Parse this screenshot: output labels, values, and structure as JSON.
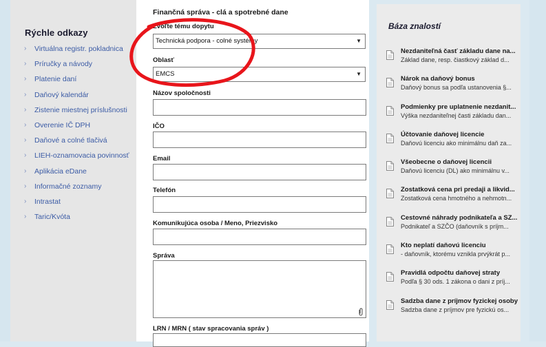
{
  "sidebar": {
    "heading": "Rýchle odkazy",
    "links": [
      "Virtuálna registr. pokladnica",
      "Príručky a návody",
      "Platenie daní",
      "Daňový kalendár",
      "Zistenie miestnej príslušnosti",
      "Overenie IČ DPH",
      "Daňové a colné tlačivá",
      "LIEH-oznamovacia povinnosť",
      "Aplikácia eDane",
      "Informačné zoznamy",
      "Intrastat",
      "Taric/Kvóta"
    ],
    "chevron_icon": "chevron-right-icon"
  },
  "form": {
    "title": "Finančná správa - clá a spotrebné dane",
    "topic_label": "Zvoľte tému dopytu",
    "topic_value": "Technická podpora - colné systémy",
    "area_label": "Oblasť",
    "area_value": "EMCS",
    "company_label": "Názov spoločnosti",
    "ico_label": "IČO",
    "email_label": "Email",
    "phone_label": "Telefón",
    "contact_label": "Komunikujúca osoba / Meno, Priezvisko",
    "message_label": "Správa",
    "lrn_label": "LRN / MRN ( stav spracovania správ )"
  },
  "annotation": {
    "color": "#e8151b",
    "shape": "hand-drawn-ellipse"
  },
  "knowledge_base": {
    "title": "Báza znalostí",
    "items": [
      {
        "title": "Nezdaniteľná časť základu dane na...",
        "snippet": "Základ dane, resp. čiastkový základ d..."
      },
      {
        "title": "Nárok na daňový bonus",
        "snippet": "Daňový bonus sa podľa ustanovenia §..."
      },
      {
        "title": "Podmienky pre uplatnenie nezdanit...",
        "snippet": "Výška nezdaniteľnej časti základu dan..."
      },
      {
        "title": "Účtovanie daňovej licencie",
        "snippet": "Daňovú licenciu ako minimálnu daň za..."
      },
      {
        "title": "Všeobecne o daňovej licencii",
        "snippet": "Daňovú licenciu (DL) ako minimálnu v..."
      },
      {
        "title": "Zostatková cena pri predaji a likvid...",
        "snippet": "Zostatková cena hmotného a nehmotn..."
      },
      {
        "title": "Cestovné náhrady podnikateľa a SZ...",
        "snippet": "Podnikateľ a SZČO (daňovník s príjm..."
      },
      {
        "title": "Kto neplatí daňovú licenciu",
        "snippet": "- daňovník, ktorému vznikla prvýkrát p..."
      },
      {
        "title": "Pravidlá odpočtu daňovej straty",
        "snippet": "Podľa § 30 ods. 1 zákona o dani z príj..."
      },
      {
        "title": "Sadzba dane z príjmov fyzickej osoby",
        "snippet": "Sadzba dane z príjmov pre fyzickú os..."
      }
    ],
    "item_icon": "document-icon"
  }
}
